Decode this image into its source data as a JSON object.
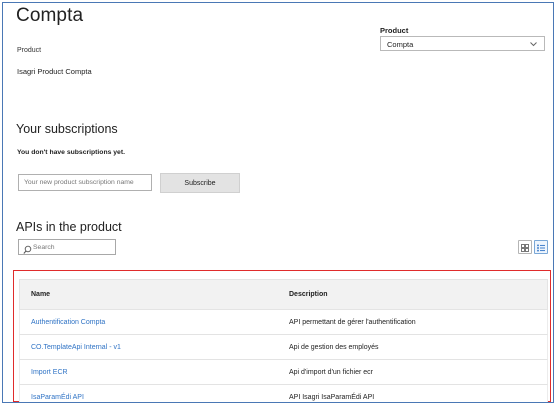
{
  "header": {
    "title": "Compta",
    "product_label": "Product",
    "product_value": "Isagri Product Compta"
  },
  "product_select": {
    "label": "Product",
    "value": "Compta"
  },
  "subscriptions": {
    "heading": "Your subscriptions",
    "empty_text": "You don't have subscriptions yet.",
    "input_placeholder": "Your new product subscription name",
    "button_label": "Subscribe"
  },
  "apis": {
    "heading": "APIs in the product",
    "search_placeholder": "Search",
    "columns": [
      "Name",
      "Description"
    ],
    "rows": [
      {
        "name": "Authentification Compta",
        "description": "API permettant de gérer l'authentification"
      },
      {
        "name": "CO.TemplateApi Internal - v1",
        "description": "Api de gestion des employés"
      },
      {
        "name": "Import ECR",
        "description": "Api d'import d'un fichier ecr"
      },
      {
        "name": "IsaParamÉdi API",
        "description": "API Isagri IsaParamÉdi API"
      }
    ]
  },
  "colors": {
    "link": "#2f73c5",
    "highlight_border": "#e02b2b",
    "frame_border": "#4a78b5"
  }
}
